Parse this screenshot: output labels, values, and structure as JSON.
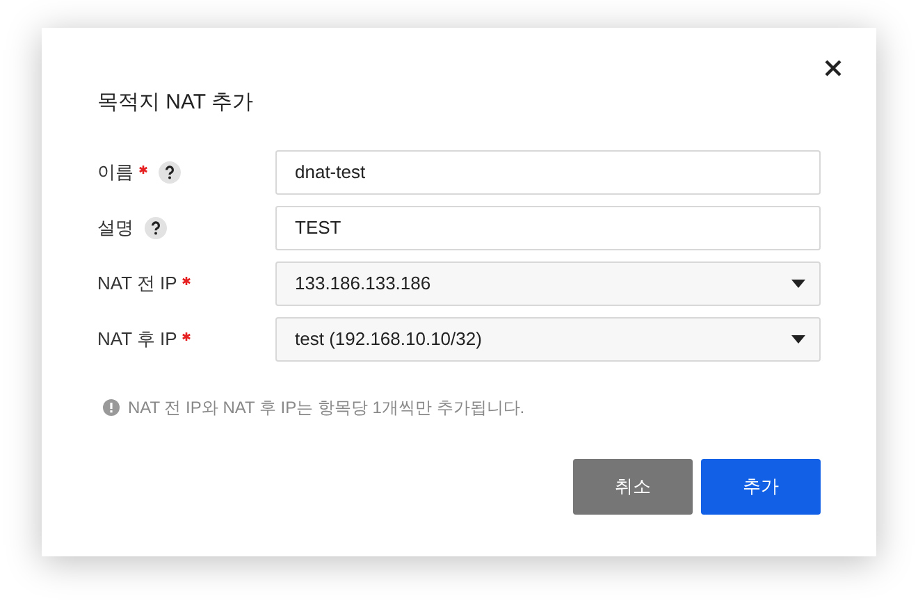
{
  "dialog": {
    "title": "목적지 NAT 추가",
    "fields": [
      {
        "label": "이름",
        "required": true,
        "help": true,
        "kind": "text",
        "value": "dnat-test"
      },
      {
        "label": "설명",
        "required": false,
        "help": true,
        "kind": "text",
        "value": "TEST"
      },
      {
        "label": "NAT 전 IP",
        "required": true,
        "help": false,
        "kind": "select",
        "value": "133.186.133.186"
      },
      {
        "label": "NAT 후 IP",
        "required": true,
        "help": false,
        "kind": "select",
        "value": "test (192.168.10.10/32)"
      }
    ],
    "note": "NAT 전 IP와 NAT 후 IP는 항목당 1개씩만 추가됩니다.",
    "buttons": [
      {
        "label": "취소",
        "kind": "secondary"
      },
      {
        "label": "추가",
        "kind": "primary"
      }
    ]
  }
}
